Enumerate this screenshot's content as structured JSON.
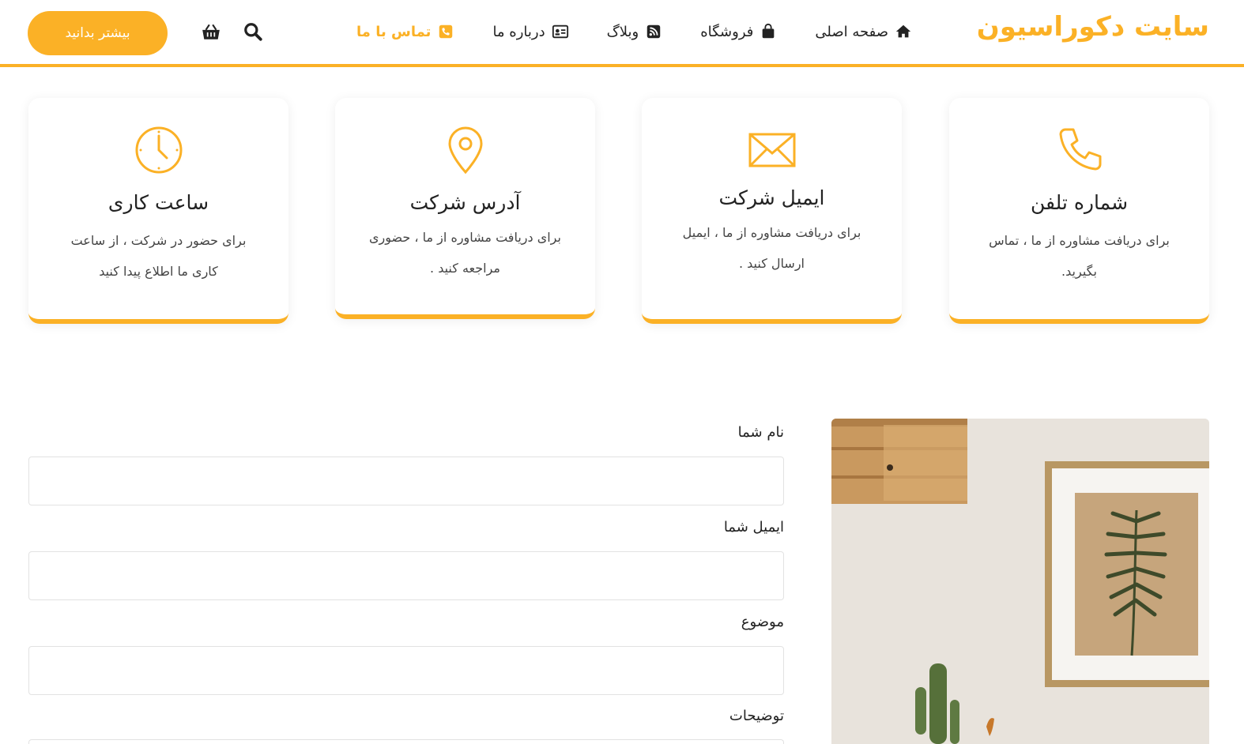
{
  "header": {
    "logo": "سایت دکوراسیون",
    "nav": [
      {
        "label": "صفحه اصلی",
        "icon": "home-icon"
      },
      {
        "label": "فروشگاه",
        "icon": "shopping-bag-icon"
      },
      {
        "label": "وبلاگ",
        "icon": "rss-icon"
      },
      {
        "label": "درباره ما",
        "icon": "id-card-icon"
      },
      {
        "label": "تماس با ما",
        "icon": "phone-square-icon",
        "active": true
      }
    ],
    "search_icon": "search-icon",
    "cart_icon": "basket-icon",
    "cta_label": "بیشتر بدانید"
  },
  "cards": [
    {
      "icon": "phone-icon",
      "title": "شماره تلفن",
      "line1": "برای دریافت مشاوره از ما ، تماس",
      "line2": "بگیرید."
    },
    {
      "icon": "envelope-icon",
      "title": "ایمیل شرکت",
      "line1": "برای دریافت مشاوره از ما ، ایمیل",
      "line2": "ارسال کنید ."
    },
    {
      "icon": "map-pin-icon",
      "title": "آدرس شرکت",
      "line1": "برای دریافت مشاوره از ما ، حضوری",
      "line2": "مراجعه کنید ."
    },
    {
      "icon": "clock-icon",
      "title": "ساعت کاری",
      "line1": "برای حضور در شرکت ، از ساعت",
      "line2": "کاری ما اطلاع پیدا کنید"
    }
  ],
  "form": {
    "name_label": "نام شما",
    "email_label": "ایمیل شما",
    "subject_label": "موضوع",
    "description_label": "توضیحات"
  },
  "colors": {
    "accent": "#fbb126",
    "text": "#222222"
  }
}
